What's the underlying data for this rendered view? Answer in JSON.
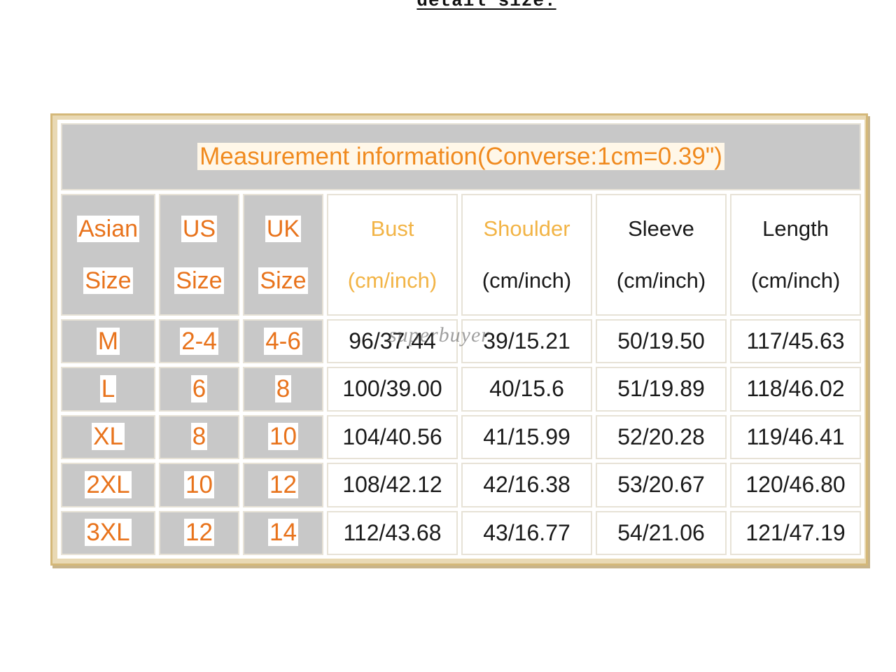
{
  "caption": "detail size:",
  "table": {
    "title": "Measurement information(Converse:1cm=0.39\")",
    "headers": [
      {
        "line1": "Asian",
        "line2": "Size"
      },
      {
        "line1": "US",
        "line2": "Size"
      },
      {
        "line1": "UK",
        "line2": "Size"
      },
      {
        "line1": "Bust",
        "line2": "(cm/inch)"
      },
      {
        "line1": "Shoulder",
        "line2": "(cm/inch)"
      },
      {
        "line1": "Sleeve",
        "line2": "(cm/inch)"
      },
      {
        "line1": "Length",
        "line2": "(cm/inch)"
      }
    ],
    "rows": [
      [
        "M",
        "2-4",
        "4-6",
        "96/37.44",
        "39/15.21",
        "50/19.50",
        "117/45.63"
      ],
      [
        "L",
        "6",
        "8",
        "100/39.00",
        "40/15.6",
        "51/19.89",
        "118/46.02"
      ],
      [
        "XL",
        "8",
        "10",
        "104/40.56",
        "41/15.99",
        "52/20.28",
        "119/46.41"
      ],
      [
        "2XL",
        "10",
        "12",
        "108/42.12",
        "42/16.38",
        "53/20.67",
        "120/46.80"
      ],
      [
        "3XL",
        "12",
        "14",
        "112/43.68",
        "43/16.77",
        "54/21.06",
        "121/47.19"
      ]
    ]
  },
  "watermark": "superbuyer",
  "colors": {
    "accent_orange": "#e8731c",
    "header_light_orange": "#f2b446",
    "gray_cell": "#c8c8c8",
    "frame_tan": "#d4b879"
  }
}
